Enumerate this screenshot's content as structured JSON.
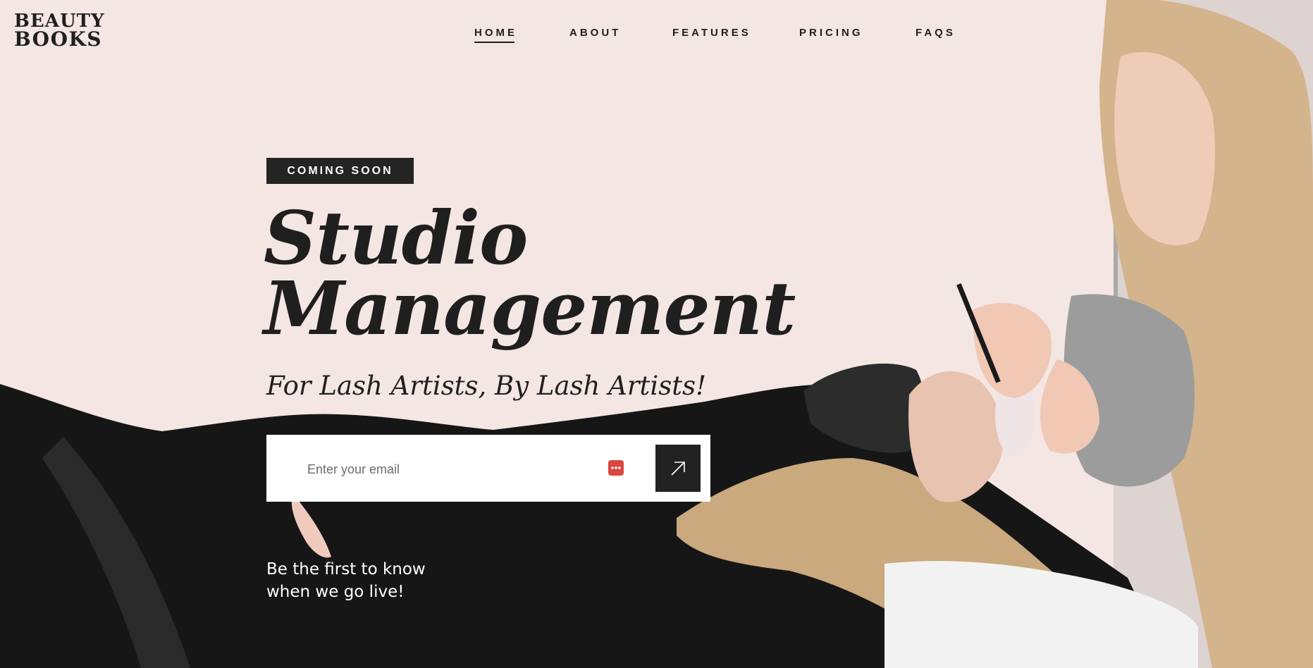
{
  "brand": {
    "line1": "BEAUTY",
    "line2": "BOOKS"
  },
  "nav": {
    "items": [
      {
        "label": "HOME",
        "active": true
      },
      {
        "label": "ABOUT",
        "active": false
      },
      {
        "label": "FEATURES",
        "active": false
      },
      {
        "label": "PRICING",
        "active": false
      },
      {
        "label": "FAQS",
        "active": false
      }
    ]
  },
  "hero": {
    "badge": "COMING SOON",
    "title_line1": "Studio",
    "title_line2": "Management",
    "subtitle": "For Lash Artists, By Lash Artists!",
    "email_placeholder": "Enter your email",
    "note_line1": "Be the first to know",
    "note_line2": "when we go live!"
  },
  "icons": {
    "autofill": "password-manager-icon",
    "submit": "arrow-up-right-icon"
  },
  "colors": {
    "background": "#f3e6e3",
    "ink": "#1f1f1f",
    "badge": "#242424",
    "autofill": "#d9473f"
  }
}
